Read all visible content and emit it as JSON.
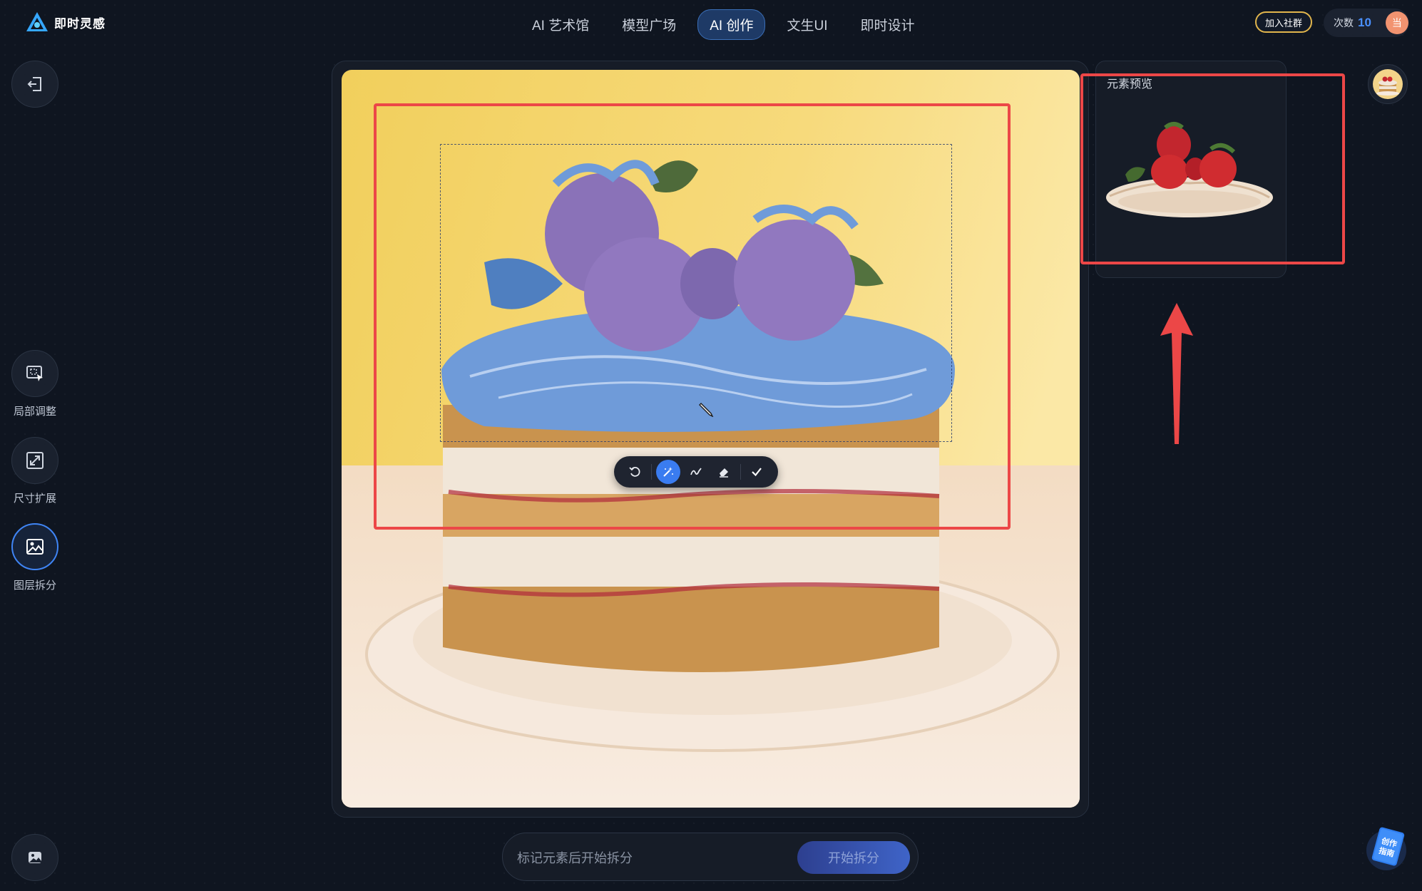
{
  "app": {
    "name": "即时灵感"
  },
  "nav": {
    "items": [
      {
        "label": "AI 艺术馆",
        "active": false
      },
      {
        "label": "模型广场",
        "active": false
      },
      {
        "label": "AI 创作",
        "active": true
      },
      {
        "label": "文生UI",
        "active": false
      },
      {
        "label": "即时设计",
        "active": false
      }
    ]
  },
  "header": {
    "join_label": "加入社群",
    "credits_label": "次数",
    "credits_value": "10",
    "user_initial": "当"
  },
  "tools": {
    "exit_icon": "exit-icon",
    "items": [
      {
        "label": "局部调整",
        "icon": "local-adjust-icon",
        "active": false
      },
      {
        "label": "尺寸扩展",
        "icon": "size-expand-icon",
        "active": false
      },
      {
        "label": "图层拆分",
        "icon": "layer-split-icon",
        "active": true
      }
    ],
    "bottom_icon": "image-icon"
  },
  "canvas": {
    "toolbar": [
      "undo-icon",
      "smart-select-icon",
      "brush-icon",
      "eraser-icon",
      "confirm-icon"
    ],
    "selected_tool": "smart-select-icon"
  },
  "preview": {
    "title": "元素预览"
  },
  "bottom": {
    "placeholder": "标记元素后开始拆分",
    "start_label": "开始拆分"
  },
  "guide": {
    "label": "创作指南"
  },
  "colors": {
    "accent": "#3f84f4",
    "annotation": "#ec4747",
    "mask": "#6f9bd9",
    "background": "#0f1520"
  }
}
